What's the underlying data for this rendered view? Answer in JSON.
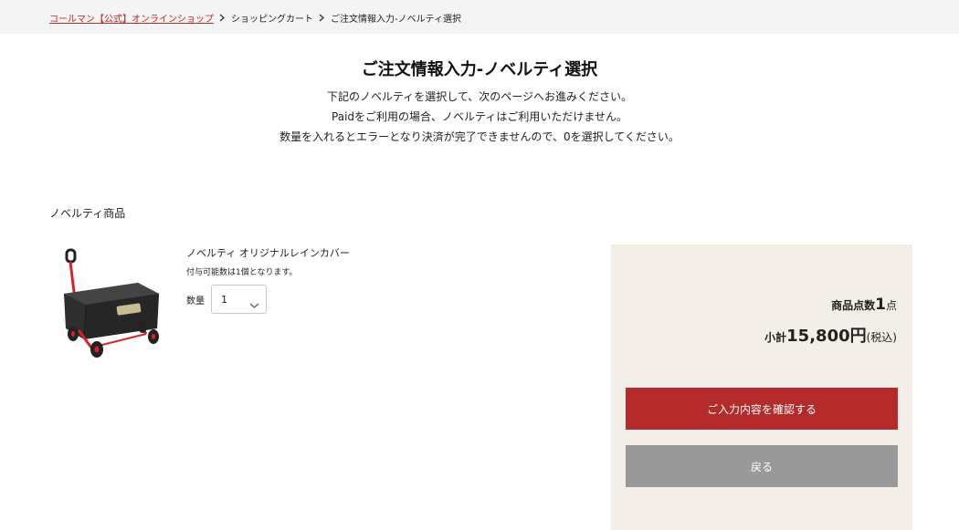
{
  "breadcrumb": {
    "home": "コールマン【公式】オンラインショップ",
    "cart": "ショッピングカート",
    "current": "ご注文情報入力-ノベルティ選択"
  },
  "page": {
    "title": "ご注文情報入力-ノベルティ選択",
    "intro_line1": "下記のノベルティを選択して、次のページへお進みください。",
    "intro_line2": "Paidをご利用の場合、ノベルティはご利用いただけません。",
    "intro_line3": "数量を入れるとエラーとなり決済が完了できませんので、0を選択してください。"
  },
  "novelty": {
    "section_title": "ノベルティ商品",
    "product_name": "ノベルティ オリジナルレインカバー",
    "note": "付与可能数は1個となります。",
    "qty_label": "数量",
    "qty_value": "1",
    "image_icon": "wagon-rain-cover-image"
  },
  "summary": {
    "count_label": "商品点数",
    "count_value": "1",
    "count_unit": "点",
    "subtotal_label": "小計",
    "subtotal_value": "15,800円",
    "tax_note": "(税込)",
    "confirm_button": "ご入力内容を確認する",
    "back_button": "戻る"
  },
  "colors": {
    "accent": "#b52a2a",
    "back_button": "#999999",
    "summary_bg": "#f3efe8",
    "breadcrumb_bg": "#f4f4f4"
  }
}
